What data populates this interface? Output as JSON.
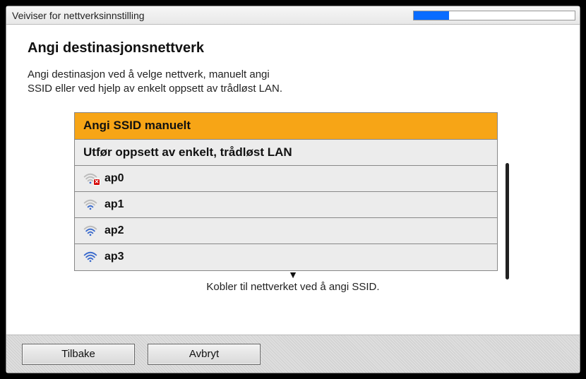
{
  "titlebar": {
    "title": "Veiviser for nettverksinnstilling",
    "progress_percent": 22
  },
  "main": {
    "heading": "Angi destinasjonsnettverk",
    "description_line1": "Angi destinasjon ved å velge nettverk, manuelt angi",
    "description_line2": "SSID eller ved hjelp av enkelt oppsett av trådløst LAN.",
    "hint": "Kobler til nettverket ved å angi SSID."
  },
  "list": {
    "items": [
      {
        "label": "Angi SSID manuelt",
        "selected": true,
        "type": "action"
      },
      {
        "label": "Utfør oppsett av enkelt, trådløst LAN",
        "selected": false,
        "type": "action"
      },
      {
        "label": "ap0",
        "selected": false,
        "type": "wifi",
        "signal": "weak",
        "bad": true
      },
      {
        "label": "ap1",
        "selected": false,
        "type": "wifi",
        "signal": "medium",
        "bad": false
      },
      {
        "label": "ap2",
        "selected": false,
        "type": "wifi",
        "signal": "medium",
        "bad": false
      },
      {
        "label": "ap3",
        "selected": false,
        "type": "wifi",
        "signal": "strong",
        "bad": false
      }
    ]
  },
  "footer": {
    "back_label": "Tilbake",
    "cancel_label": "Avbryt"
  }
}
